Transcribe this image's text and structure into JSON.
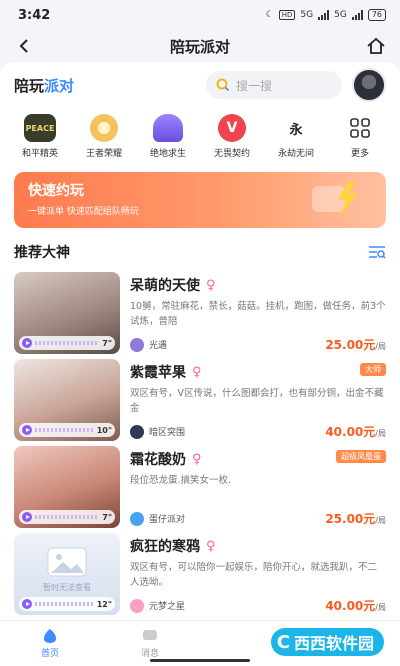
{
  "status": {
    "time": "3:42",
    "battery": "76",
    "net1": "5G",
    "net2": "5G",
    "hd": "HD"
  },
  "nav": {
    "title": "陪玩派对"
  },
  "brand": {
    "part1": "陪玩",
    "part2": "派对"
  },
  "search": {
    "placeholder": "搜一搜"
  },
  "games": [
    {
      "label": "和平精英",
      "icon": "peace-elite-icon",
      "color": "#3b3b2a"
    },
    {
      "label": "王者荣耀",
      "icon": "honor-of-kings-icon",
      "color": "#f3c35a"
    },
    {
      "label": "绝地求生",
      "icon": "pubg-helmet-icon",
      "color": "#8b6cf2"
    },
    {
      "label": "无畏契约",
      "icon": "valorant-icon",
      "color": "#f0454f"
    },
    {
      "label": "永劫无间",
      "icon": "naraka-icon",
      "color": "#222222"
    },
    {
      "label": "更多",
      "icon": "grid-more-icon",
      "color": "#333333"
    }
  ],
  "banner": {
    "title": "快速约玩",
    "subtitle": "一键派单 快速匹配组队畅玩"
  },
  "section": {
    "title": "推荐大神"
  },
  "cards": [
    {
      "name": "呆萌的天使",
      "desc": "10舅，常驻麻花，禁长，菇菇。挂机，跑图，做任务，前3个试炼，普陪",
      "game": "光遇",
      "price": "25.00元",
      "unit": "/局",
      "duration": "7\"",
      "tag": "",
      "thumb": [
        "#c9b8b0",
        "#6b5550"
      ]
    },
    {
      "name": "紫霞苹果",
      "desc": "双区有号，V区传说，什么图都会打，也有部分铜，出金不藏金",
      "game": "暗区突围",
      "price": "40.00元",
      "unit": "/局",
      "duration": "10\"",
      "tag": "大师",
      "tagColor": "#ff8a4a",
      "thumb": [
        "#e9ddd8",
        "#a77f6c"
      ]
    },
    {
      "name": "霜花酸奶",
      "desc": "段位恐龙蛋.搞笑女一枚.",
      "game": "蛋仔派对",
      "price": "25.00元",
      "unit": "/局",
      "duration": "7\"",
      "tag": "超级凤凰蛋",
      "tagColor": "#ff8a4a",
      "thumb": [
        "#e8b7ae",
        "#8a4b3d"
      ]
    },
    {
      "name": "疯狂的寒鸦",
      "desc": "双区有号，可以陪你一起娱乐，陪你开心，就选我趴，不二人选呦。",
      "game": "元梦之星",
      "price": "40.00元",
      "unit": "/局",
      "duration": "12\"",
      "tag": "",
      "thumb": [
        "#e6ecf6",
        "#c7d3e8"
      ],
      "watermark": "暂时无法查看"
    }
  ],
  "tabs": [
    {
      "label": "首页"
    },
    {
      "label": "消息"
    }
  ],
  "watermark": {
    "text": "西西软件园"
  },
  "colors": {
    "accent": "#3d8bff",
    "price": "#ff5a1f",
    "female": "#ff5fa2"
  }
}
